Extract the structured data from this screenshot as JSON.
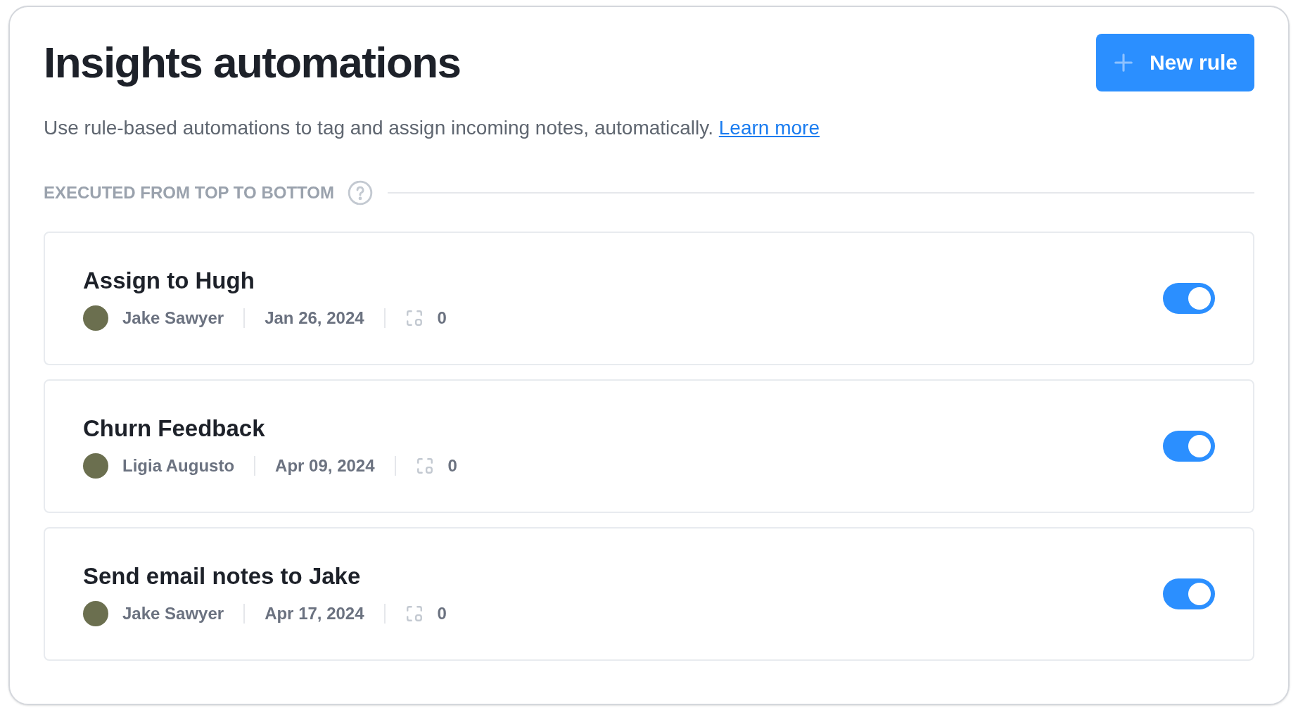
{
  "header": {
    "title": "Insights automations",
    "new_rule_button": "New rule"
  },
  "description": {
    "text": "Use rule-based automations to tag and assign incoming notes, automatically.",
    "link": "Learn more"
  },
  "section": {
    "heading": "EXECUTED FROM TOP TO BOTTOM"
  },
  "rules": [
    {
      "name": "Assign to Hugh",
      "author": "Jake Sawyer",
      "date": "Jan 26, 2024",
      "count": "0",
      "on": true
    },
    {
      "name": "Churn Feedback",
      "author": "Ligia Augusto",
      "date": "Apr 09, 2024",
      "count": "0",
      "on": true
    },
    {
      "name": "Send email notes to Jake",
      "author": "Jake Sawyer",
      "date": "Apr 17, 2024",
      "count": "0",
      "on": true
    }
  ]
}
